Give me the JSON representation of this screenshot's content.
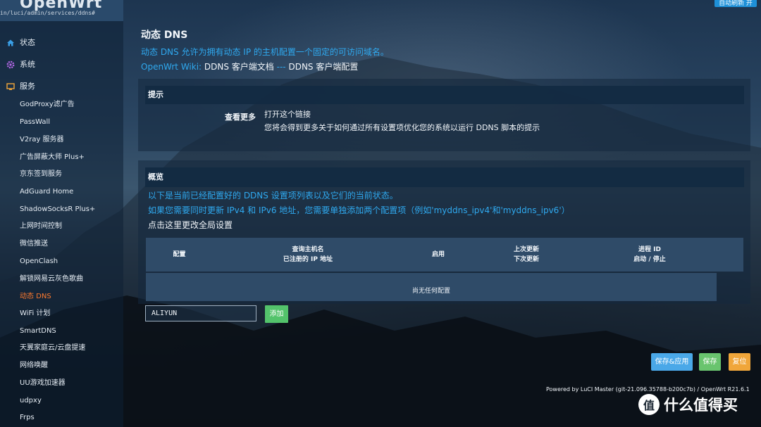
{
  "header": {
    "logo": "OpenWrt",
    "url": "in/luci/admin/services/ddns#",
    "refresh_label": "自动刷新 开"
  },
  "sidebar": {
    "top_items": [
      {
        "label": "状态",
        "icon": "home-icon"
      },
      {
        "label": "系统",
        "icon": "gear-icon"
      },
      {
        "label": "服务",
        "icon": "services-icon"
      }
    ],
    "sub_items": [
      "GodProxy滤广告",
      "PassWall",
      "V2ray 服务器",
      "广告屏蔽大师 Plus+",
      "京东签到服务",
      "AdGuard Home",
      "ShadowSocksR Plus+",
      "上网时间控制",
      "微信推送",
      "OpenClash",
      "解锁网易云灰色歌曲",
      "动态 DNS",
      "WiFi 计划",
      "SmartDNS",
      "天翼家庭云/云盘提速",
      "网络唤醒",
      "UU游戏加速器",
      "udpxy",
      "Frps"
    ],
    "active_item": "动态 DNS"
  },
  "main": {
    "title": "动态 DNS",
    "description": "动态 DNS 允许为拥有动态 IP 的主机配置一个固定的可访问域名。",
    "wiki_prefix": "OpenWrt Wiki:",
    "wiki_link1": "DDNS 客户端文档",
    "wiki_sep": "---",
    "wiki_link2": "DDNS 客户端配置",
    "hint": {
      "heading": "提示",
      "label": "查看更多",
      "line1": "打开这个链接",
      "line2": "您将会得到更多关于如何通过所有设置项优化您的系统以运行 DDNS 脚本的提示"
    },
    "overview": {
      "heading": "概览",
      "line1": "以下是当前已经配置好的 DDNS 设置项列表以及它们的当前状态。",
      "line2": "如果您需要同时更新 IPv4 和 IPv6 地址，您需要单独添加两个配置项（例如'myddns_ipv4'和'myddns_ipv6'）",
      "line3": "点击这里更改全局设置",
      "columns": [
        {
          "line1": "配置",
          "line2": ""
        },
        {
          "line1": "查询主机名",
          "line2": "已注册的 IP 地址"
        },
        {
          "line1": "启用",
          "line2": ""
        },
        {
          "line1": "上次更新",
          "line2": "下次更新"
        },
        {
          "line1": "进程 ID",
          "line2": "启动 / 停止"
        }
      ],
      "empty_text": "尚无任何配置",
      "input_value": "ALIYUN",
      "add_label": "添加"
    },
    "actions": {
      "save_apply": "保存&应用",
      "save": "保存",
      "reset": "复位"
    },
    "footer": "Powered by LuCI Master (git-21.096.35788-b200c7b) / OpenWrt R21.6.1"
  },
  "watermark": {
    "icon_char": "值",
    "text": "什么值得买"
  },
  "colors": {
    "link_blue": "#2fa9ef",
    "active_orange": "#ff7a2e",
    "add_green": "#53c36b",
    "save_apply_blue": "#4aa8e8",
    "save_green": "#69c46e",
    "reset_orange": "#f0a63a"
  }
}
